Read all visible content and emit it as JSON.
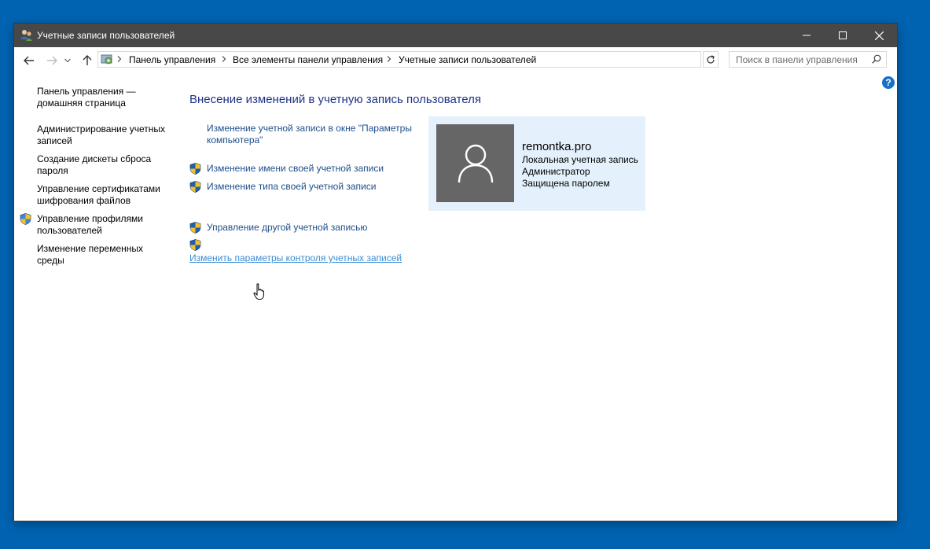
{
  "window": {
    "title": "Учетные записи пользователей"
  },
  "address": {
    "crumbs": [
      "Панель управления",
      "Все элементы панели управления",
      "Учетные записи пользователей"
    ],
    "search_placeholder": "Поиск в панели управления"
  },
  "sidebar": {
    "items": [
      {
        "label": "Панель управления — домашняя страница",
        "shield": false
      },
      {
        "label": "Администрирование учетных записей",
        "shield": false
      },
      {
        "label": "Создание дискеты сброса пароля",
        "shield": false
      },
      {
        "label": "Управление сертификатами шифрования файлов",
        "shield": false
      },
      {
        "label": "Управление профилями пользователей",
        "shield": true
      },
      {
        "label": "Изменение переменных среды",
        "shield": false
      }
    ]
  },
  "main": {
    "heading": "Внесение изменений в учетную запись пользователя",
    "links": {
      "change_in_settings": "Изменение учетной записи в окне \"Параметры компьютера\"",
      "rename": "Изменение имени своей учетной записи",
      "change_type": "Изменение типа своей учетной записи",
      "manage_other": "Управление другой учетной записью",
      "uac_settings": "Изменить параметры контроля учетных записей"
    }
  },
  "user": {
    "name": "remontka.pro",
    "account_type": "Локальная учетная запись",
    "role": "Администратор",
    "protection": "Защищена паролем"
  },
  "colors": {
    "desktop": "#0063b1",
    "titlebar": "#484848",
    "link": "#1e4e8c",
    "heading": "#1e3287",
    "card": "#e4f1fc"
  }
}
